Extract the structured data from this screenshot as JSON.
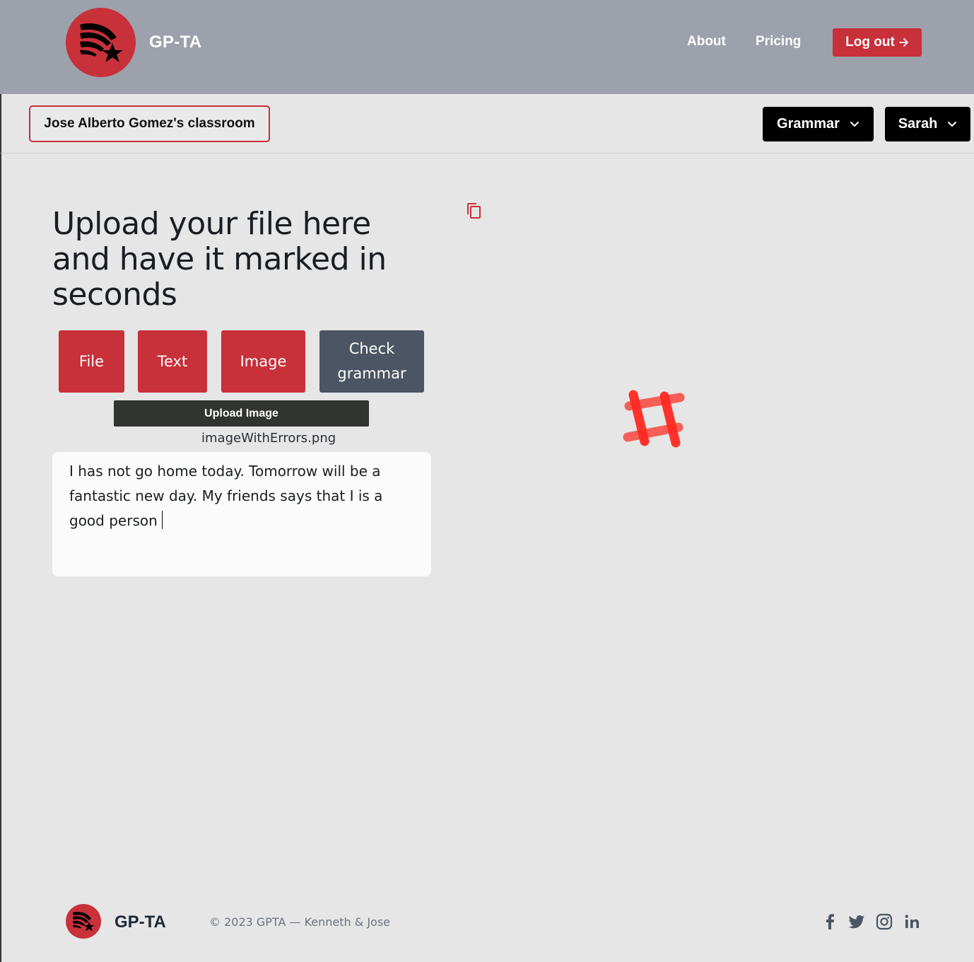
{
  "header": {
    "brand": "GP-TA",
    "nav": {
      "about": "About",
      "pricing": "Pricing"
    },
    "logout_label": "Log out",
    "logout_icon": "arrow-right-icon"
  },
  "classbar": {
    "classroom": "Jose Alberto Gomez's classroom",
    "mode_dropdown": "Grammar",
    "student_dropdown": "Sarah"
  },
  "main": {
    "headline": "Upload your file here and have it marked in seconds",
    "buttons": {
      "file": "File",
      "text": "Text",
      "image": "Image",
      "check": "Check grammar"
    },
    "upload_label": "Upload Image",
    "filename": "imageWithErrors.png",
    "input_text": "I has not go home today. Tomorrow will be a fantastic new day. My friends says that I is a good person",
    "icons": [
      "copy-icon",
      "loading-spinner-icon"
    ]
  },
  "footer": {
    "brand": "GP-TA",
    "copyright": "© 2023 GPTA — Kenneth & Jose",
    "social": [
      "facebook-icon",
      "twitter-icon",
      "instagram-icon",
      "linkedin-icon"
    ]
  },
  "colors": {
    "header_bg": "#9ca1ab",
    "accent_red": "#c8303a",
    "page_bg": "#e6e6e6",
    "check_button": "#4b5563",
    "upload_button": "#323431"
  }
}
